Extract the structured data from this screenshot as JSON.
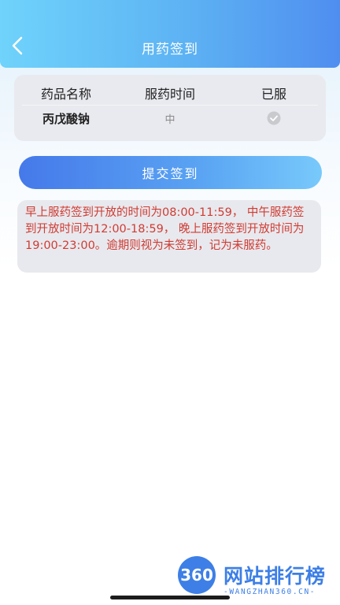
{
  "header": {
    "title": "用药签到",
    "back_icon": "chevron-left-icon"
  },
  "table": {
    "columns": [
      "药品名称",
      "服药时间",
      "已服"
    ],
    "rows": [
      {
        "drug": "丙戊酸钠",
        "time": "中",
        "taken": "check-circle-icon"
      }
    ]
  },
  "submit_label": "提交签到",
  "notice": "早上服药签到开放的时间为08:00-11:59， 中午服药签到开放时间为12:00-18:59， 晚上服药签到开放时间为19:00-23:00。逾期则视为未签到，记为未服药。",
  "watermark": {
    "logo_text": "360",
    "title": "网站排行榜",
    "subtitle": "-WANGZHAN360.CN-"
  },
  "colors": {
    "header_start": "#6fd3fb",
    "header_end": "#4f8ef0",
    "notice_text": "#d03b32",
    "button_start": "#4579ea",
    "button_end": "#78c9fb"
  }
}
